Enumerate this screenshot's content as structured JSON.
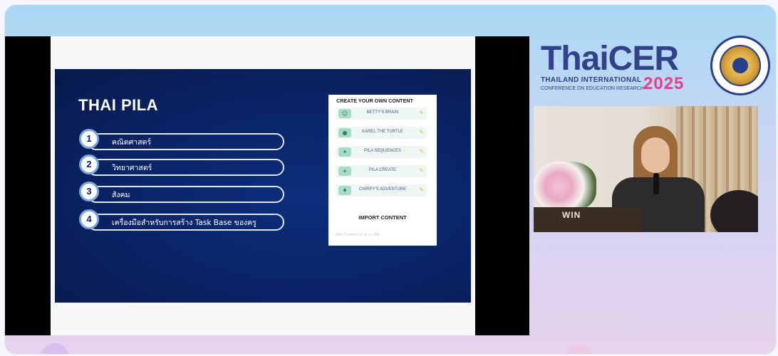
{
  "conference": {
    "logo_main_a": "Thai",
    "logo_main_b": "CER",
    "subtitle_line1": "THAILAND INTERNATIONAL",
    "subtitle_line2": "CONFERENCE ON EDUCATION RESEARCH",
    "year": "2025"
  },
  "slide": {
    "title": "THAI PILA",
    "items": [
      {
        "number": "1",
        "label": "คณิตศาสตร์"
      },
      {
        "number": "2",
        "label": "วิทยาศาสตร์"
      },
      {
        "number": "3",
        "label": "สังคม"
      },
      {
        "number": "4",
        "label": "เครื่องมือสำหรับการสร้าง Task Base ของครู"
      }
    ],
    "panel": {
      "title": "CREATE YOUR OWN CONTENT",
      "rows": [
        {
          "label": "BETTY'S BRAIN"
        },
        {
          "label": "KAREL THE TURTLE"
        },
        {
          "label": "PILA SEQUENCES"
        },
        {
          "label": "PILA CREATE"
        },
        {
          "label": "CHIRPY'S ADVENTURE"
        }
      ],
      "import_label": "IMPORT CONTENT",
      "add_placeholder": "Add Content by Id or URL"
    }
  },
  "camera": {
    "podium_text": "WIN"
  }
}
